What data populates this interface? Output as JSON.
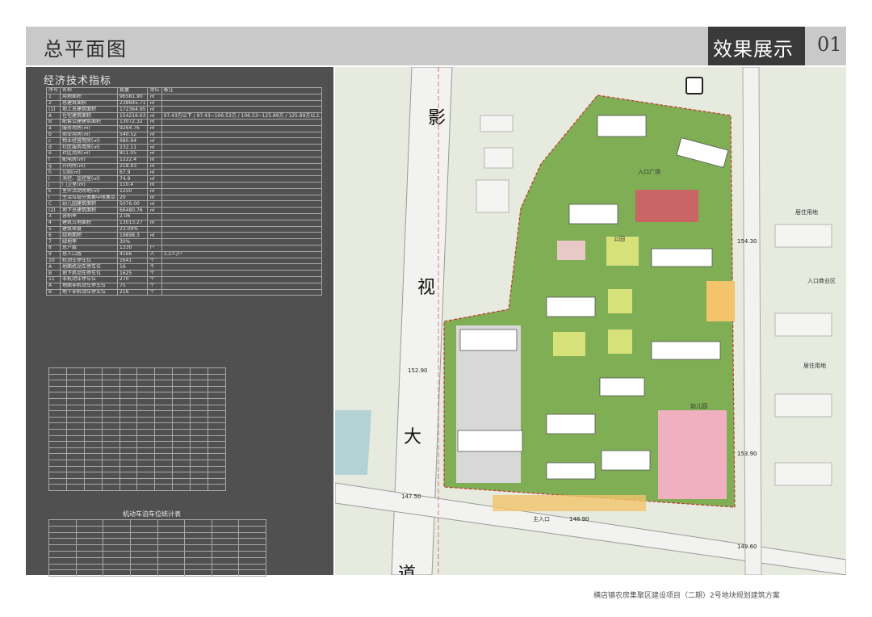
{
  "header": {
    "title": "总平面图",
    "section_title": "效果展示",
    "section_number": "01"
  },
  "panel": {
    "title": "经济技术指标",
    "table_headers": [
      "序号",
      "名称",
      "数量",
      "单位",
      "备注"
    ],
    "table_rows": [
      [
        "1",
        "用地面积",
        "96581.90",
        "㎡",
        ""
      ],
      [
        "2",
        "总建筑面积",
        "238645.71",
        "㎡",
        ""
      ],
      [
        "(1)",
        "地上总建筑面积",
        "172364.95",
        "㎡",
        ""
      ],
      [
        "A",
        "住宅建筑面积",
        "154216.63",
        "㎡",
        "97.43方以下 / 97.43~106.53方 / 106.53~125.89方 / 125.89方以上"
      ],
      [
        "B",
        "配套公建建筑面积",
        "13072.32",
        "㎡",
        ""
      ],
      [
        "a",
        "服务用房(㎡)",
        "9264.76",
        "㎡",
        ""
      ],
      [
        "b",
        "商业用房(㎡)",
        "540.52",
        "㎡",
        ""
      ],
      [
        "c",
        "物业经营用房(㎡)",
        "680.94",
        "㎡",
        ""
      ],
      [
        "d",
        "社区服务用房(㎡)",
        "232.11",
        "㎡",
        ""
      ],
      [
        "e",
        "社区用房(㎡)",
        "811.05",
        "㎡",
        ""
      ],
      [
        "f",
        "配电房(㎡)",
        "1222.4",
        "㎡",
        ""
      ],
      [
        "g",
        "开闭所(㎡)",
        "218.93",
        "㎡",
        ""
      ],
      [
        "h",
        "公厕(㎡)",
        "67.9",
        "㎡",
        ""
      ],
      [
        "i",
        "消控、监控室(㎡)",
        "74.9",
        "㎡",
        ""
      ],
      [
        "j",
        "门卫室(㎡)",
        "110.4",
        "㎡",
        ""
      ],
      [
        "k",
        "室外活动场地(㎡)",
        "1250",
        "㎡",
        ""
      ],
      [
        "l",
        "生活垃圾分类集中收集点",
        "20",
        "㎡",
        ""
      ],
      [
        "C",
        "幼儿园建筑面积",
        "5076.00",
        "㎡",
        ""
      ],
      [
        "(2)",
        "地下总建筑面积",
        "66480.76",
        "㎡",
        ""
      ],
      [
        "3",
        "容积率",
        "2.06",
        "",
        ""
      ],
      [
        "4",
        "建筑占地面积",
        "13013.27",
        "㎡",
        ""
      ],
      [
        "5",
        "建筑密度",
        "23.09%",
        "",
        ""
      ],
      [
        "6",
        "绿地面积",
        "19898.3",
        "㎡",
        ""
      ],
      [
        "7",
        "绿地率",
        "30%",
        "",
        ""
      ],
      [
        "8",
        "总户数",
        "1330",
        "户",
        ""
      ],
      [
        "9",
        "总人口数",
        "4166",
        "人",
        "3.2人/户"
      ],
      [
        "10",
        "机动车停车位",
        "1641",
        "个",
        ""
      ],
      [
        "A",
        "地面机动车停车位",
        "16",
        "个",
        ""
      ],
      [
        "B",
        "地下机动车停车位",
        "1625",
        "个",
        ""
      ],
      [
        "11",
        "非机动车停车位",
        "270",
        "个",
        ""
      ],
      [
        "A",
        "地面非机动车停车位",
        "75",
        "个",
        ""
      ],
      [
        "B",
        "地下非机动车停车位",
        "216",
        "个",
        ""
      ]
    ],
    "parking_caption": "机动车泊车位统计表"
  },
  "plan": {
    "road_chars": [
      "影",
      "视",
      "大",
      "道"
    ],
    "elevations": [
      "154.30",
      "152.90",
      "147.50",
      "148.90",
      "149.60",
      "153.90"
    ],
    "labels": [
      "入口广场",
      "居住用地",
      "入口商业区",
      "居住用地",
      "公园",
      "幼儿园",
      "主入口"
    ]
  },
  "footer": {
    "caption": "横店镇农房集聚区建设项目（二期）2号地块规划建筑方案"
  }
}
